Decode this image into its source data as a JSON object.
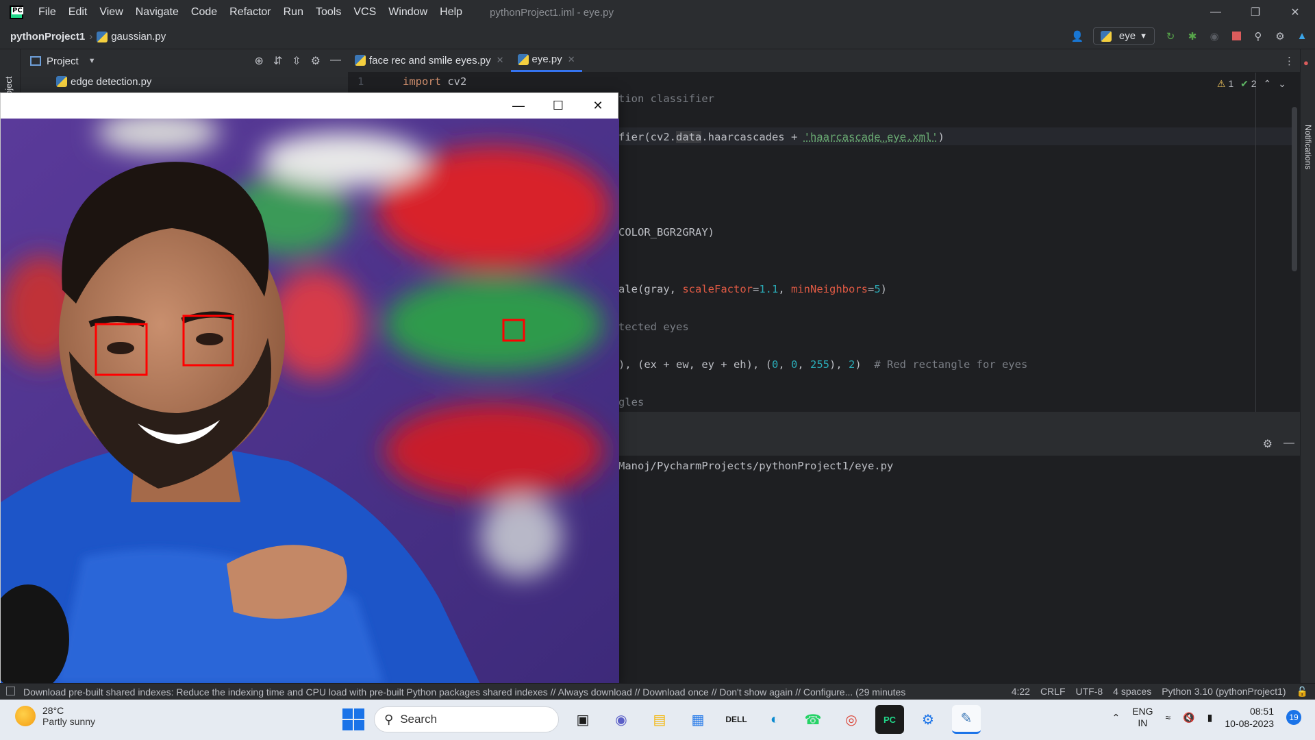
{
  "titlebar": {
    "menu": [
      "File",
      "Edit",
      "View",
      "Navigate",
      "Code",
      "Refactor",
      "Run",
      "Tools",
      "VCS",
      "Window",
      "Help"
    ],
    "window_title": "pythonProject1.iml - eye.py"
  },
  "navbar": {
    "project": "pythonProject1",
    "file": "gaussian.py",
    "run_config": "eye"
  },
  "project_panel": {
    "title": "Project",
    "items": [
      "edge detection.py"
    ]
  },
  "tool_strip": {
    "label": "Project"
  },
  "right_strip": {
    "label": "Notifications"
  },
  "tabs": [
    {
      "label": "face rec and smile eyes.py"
    },
    {
      "label": "eye.py"
    }
  ],
  "editor": {
    "inspections": {
      "warnings": "1",
      "typos": "2"
    },
    "line1_no": "1",
    "line1_kw": "import",
    "line1_rest": " cv2",
    "frag_classifier": "tion classifier",
    "frag_cascade_a": "fier(cv2.",
    "frag_cascade_b": "data",
    "frag_cascade_c": ".haarcascades + ",
    "frag_cascade_str": "'haarcascade_eye.xml'",
    "frag_cascade_d": ")",
    "frag_gray": "COLOR_BGR2GRAY)",
    "frag_detect_a": "ale(gray, ",
    "frag_detect_p1": "scaleFactor",
    "frag_detect_eq1": "=",
    "frag_detect_v1": "1.1",
    "frag_detect_sep": ", ",
    "frag_detect_p2": "minNeighbors",
    "frag_detect_eq2": "=",
    "frag_detect_v2": "5",
    "frag_detect_end": ")",
    "frag_eyes_cmt": "tected eyes",
    "frag_rect_a": "), (ex + ew, ey + eh), (",
    "frag_rect_n1": "0",
    "frag_rect_s1": ", ",
    "frag_rect_n2": "0",
    "frag_rect_s2": ", ",
    "frag_rect_n3": "255",
    "frag_rect_s3": "), ",
    "frag_rect_n4": "2",
    "frag_rect_end": ")  ",
    "frag_rect_cmt": "# Red rectangle for eyes",
    "frag_gles": "gles"
  },
  "run": {
    "output": "Manoj/PycharmProjects/pythonProject1/eye.py"
  },
  "statusbar": {
    "message": "Download pre-built shared indexes: Reduce the indexing time and CPU load with pre-built Python packages shared indexes // Always download // Download once // Don't show again // Configure... (29 minutes",
    "position": "4:22",
    "line_sep": "CRLF",
    "encoding": "UTF-8",
    "indent": "4 spaces",
    "interpreter": "Python 3.10 (pythonProject1)"
  },
  "taskbar": {
    "temp": "28°C",
    "weather": "Partly sunny",
    "search": "Search",
    "lang1": "ENG",
    "lang2": "IN",
    "time": "08:51",
    "date": "10-08-2023",
    "badge": "19"
  }
}
